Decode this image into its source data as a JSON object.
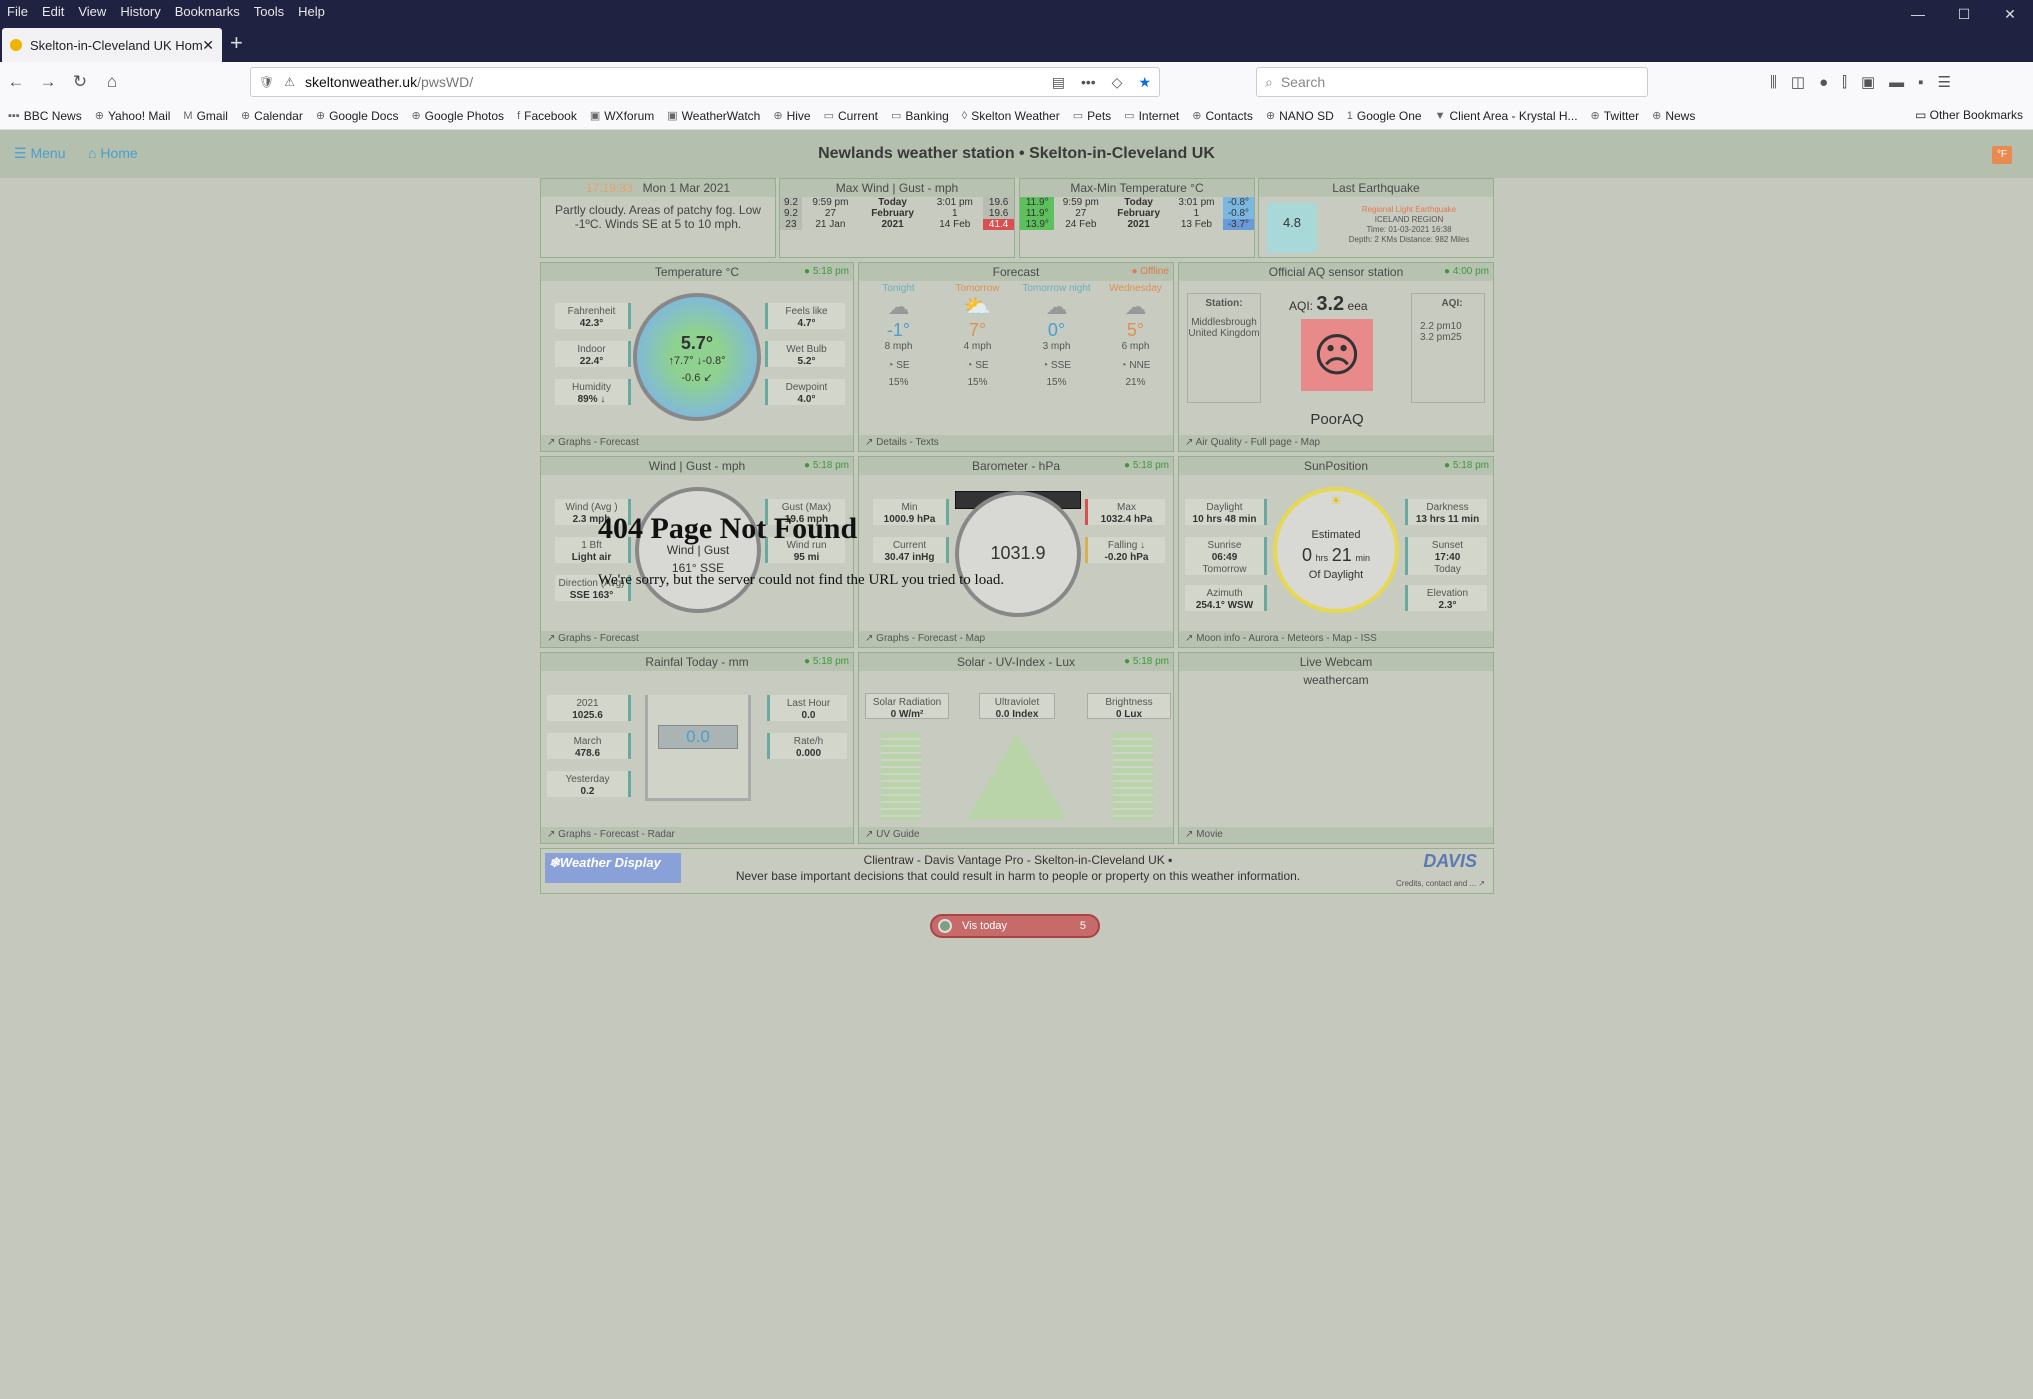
{
  "browser": {
    "menu": [
      "File",
      "Edit",
      "View",
      "History",
      "Bookmarks",
      "Tools",
      "Help"
    ],
    "tab_title": "Skelton-in-Cleveland UK Home",
    "url_host": "skeltonweather.uk",
    "url_path": "/pwsWD/",
    "search_placeholder": "Search",
    "bookmarks": [
      "BBC News",
      "Yahoo! Mail",
      "Gmail",
      "Calendar",
      "Google Docs",
      "Google Photos",
      "Facebook",
      "WXforum",
      "WeatherWatch",
      "Hive",
      "Current",
      "Banking",
      "Skelton Weather",
      "Pets",
      "Internet",
      "Contacts",
      "NANO SD",
      "Google One",
      "Client Area - Krystal H...",
      "Twitter",
      "News"
    ],
    "other_bookmarks": "Other Bookmarks"
  },
  "site": {
    "menu": "Menu",
    "home": "Home",
    "title": "Newlands weather station  •  Skelton-in-Cleveland UK",
    "unit_button": "°F"
  },
  "top": {
    "time": "17:19:33",
    "date": "Mon 1 Mar 2021",
    "forecast_text": "Partly cloudy. Areas of patchy fog. Low -1ºC. Winds SE at 5 to 10 mph.",
    "maxwind_title": "Max Wind | Gust - mph",
    "maxwind_rows": [
      [
        "9.2",
        "9:59 pm",
        "Today",
        "3:01 pm",
        "19.6"
      ],
      [
        "9.2",
        "27",
        "February",
        "1",
        "19.6"
      ],
      [
        "23",
        "21 Jan",
        "2021",
        "14 Feb",
        "41.4"
      ]
    ],
    "maxmin_title": "Max-Min Temperature °C",
    "maxmin_rows": [
      [
        "11.9°",
        "9:59 pm",
        "Today",
        "3:01 pm",
        "-0.8°"
      ],
      [
        "11.9°",
        "27",
        "February",
        "1",
        "-0.8°"
      ],
      [
        "13.9°",
        "24 Feb",
        "2021",
        "13 Feb",
        "-3.7°"
      ]
    ],
    "quake_title": "Last Earthquake",
    "quake_mag": "4.8",
    "quake_l1": "Regional Light Earthquake",
    "quake_l2": "ICELAND REGION",
    "quake_l3": "Time: 01-03-2021 16:38",
    "quake_l4": "Depth: 2 KMs Distance: 982 Miles"
  },
  "temperature": {
    "title": "Temperature °C",
    "updated": "● 5:18 pm",
    "fahrenheit_label": "Fahrenheit",
    "fahrenheit": "42.3°",
    "indoor_label": "Indoor",
    "indoor": "22.4°",
    "humidity_label": "Humidity",
    "humidity": "89% ↓",
    "feels_label": "Feels like",
    "feels": "4.7°",
    "wetbulb_label": "Wet Bulb",
    "wetbulb": "5.2°",
    "dew_label": "Dewpoint",
    "dew": "4.0°",
    "current": "5.7°",
    "hilo": "↑7.7° ↓-0.8°",
    "trend": "-0.6 ↙",
    "footer": "Graphs - Forecast"
  },
  "forecast": {
    "title": "Forecast",
    "status": "● Offline",
    "periods": [
      {
        "name": "Tonight",
        "temp": "-1°",
        "wind": "8 mph",
        "dir": "SE",
        "pop": "15%"
      },
      {
        "name": "Tomorrow",
        "temp": "7°",
        "wind": "4 mph",
        "dir": "SE",
        "pop": "15%"
      },
      {
        "name": "Tomorrow night",
        "temp": "0°",
        "wind": "3 mph",
        "dir": "SSE",
        "pop": "15%"
      },
      {
        "name": "Wednesday",
        "temp": "5°",
        "wind": "6 mph",
        "dir": "NNE",
        "pop": "21%"
      }
    ],
    "footer": "Details - Texts"
  },
  "aq": {
    "title": "Official AQ sensor station",
    "updated": "● 4:00 pm",
    "station_label": "Station:",
    "station": "Middlesbrough United Kingdom",
    "aqi_prefix": "AQI:",
    "aqi": "3.2",
    "aqi_suffix": "eea",
    "aqi2_label": "AQI:",
    "pm10": "2.2   pm10",
    "pm25": "3.2   pm25",
    "status": "PoorAQ",
    "footer": "Air Quality - Full page - Map"
  },
  "wind": {
    "title": "Wind | Gust - mph",
    "updated": "● 5:18 pm",
    "avg_label": "Wind (Avg )",
    "avg": "2.3 mph",
    "bft_label": "1 Bft",
    "bft": "Light air",
    "dir_label": "Direction (Avg)",
    "dir": "SSE 163°",
    "gust_label": "Gust (Max)",
    "gust": "19.6 mph",
    "run_label": "Wind run",
    "run": "95 mi",
    "center": "Wind | Gust",
    "center_dir": "161° SSE",
    "footer": "Graphs - Forecast"
  },
  "barometer": {
    "title": "Barometer - hPa",
    "updated": "● 5:18 pm",
    "min_label": "Min",
    "min": "1000.9 hPa",
    "cur_label": "Current",
    "cur": "30.47 inHg",
    "max_label": "Max",
    "max": "1032.4 hPa",
    "trend_label": "Falling ↓",
    "trend": "-0.20 hPa",
    "value": "1031.9",
    "footer": "Graphs - Forecast - Map"
  },
  "sun": {
    "title": "SunPosition",
    "updated": "● 5:18 pm",
    "daylight_label": "Daylight",
    "daylight": "10 hrs 48 min",
    "sunrise_label": "Sunrise",
    "sunrise": "06:49",
    "sunrise_day": "Tomorrow",
    "azimuth_label": "Azimuth",
    "azimuth": "254.1° WSW",
    "darkness_label": "Darkness",
    "darkness": "13 hrs 11 min",
    "sunset_label": "Sunset",
    "sunset": "17:40",
    "sunset_day": "Today",
    "elev_label": "Elevation",
    "elev": "2.3°",
    "center_l1": "Estimated",
    "center_h": "0",
    "center_hrs": "hrs",
    "center_m": "21",
    "center_min": "min",
    "center_l3": "Of Daylight",
    "footer": "Moon info - Aurora - Meteors - Map - ISS"
  },
  "rain": {
    "title": "Rainfal Today - mm",
    "updated": "● 5:18 pm",
    "y_label": "2021",
    "y": "1025.6",
    "m_label": "March",
    "m": "478.6",
    "yd_label": "Yesterday",
    "yd": "0.2",
    "lh_label": "Last Hour",
    "lh": "0.0",
    "rate_label": "Rate/h",
    "rate": "0.000",
    "value": "0.0",
    "footer": "Graphs - Forecast - Radar"
  },
  "solar": {
    "title": "Solar - UV-Index - Lux",
    "updated": "● 5:18 pm",
    "rad_label": "Solar Radiation",
    "rad": "0 W/m²",
    "uv_label": "Ultraviolet",
    "uv": "0.0 Index",
    "lux_label": "Brightness",
    "lux": "0 Lux",
    "footer": "UV Guide"
  },
  "webcam": {
    "title": "Live Webcam",
    "alt": "weathercam",
    "footer": "Movie"
  },
  "footer": {
    "wd_logo": "Weather Display",
    "line1": "Clientraw  -  Davis Vantage Pro  -  Skelton-in-Cleveland UK",
    "line2": "Never base important decisions that could result in harm to people or property on this weather information.",
    "davis": "DAVIS",
    "credits": "Credits, contact and ..."
  },
  "error": {
    "title": "404 Page Not Found",
    "text": "We're sorry, but the server could not find the URL you tried to load."
  },
  "visits": {
    "label": "Vis  today",
    "count": "5"
  },
  "colors": {
    "browser_chrome": "#1f2240",
    "page_bg": "#c5c8bd",
    "panel_border": "#93b08b",
    "accent_blue": "#4a9fd0",
    "updated_green": "#3a9a3a",
    "poor_aq": "#e88a8a"
  }
}
